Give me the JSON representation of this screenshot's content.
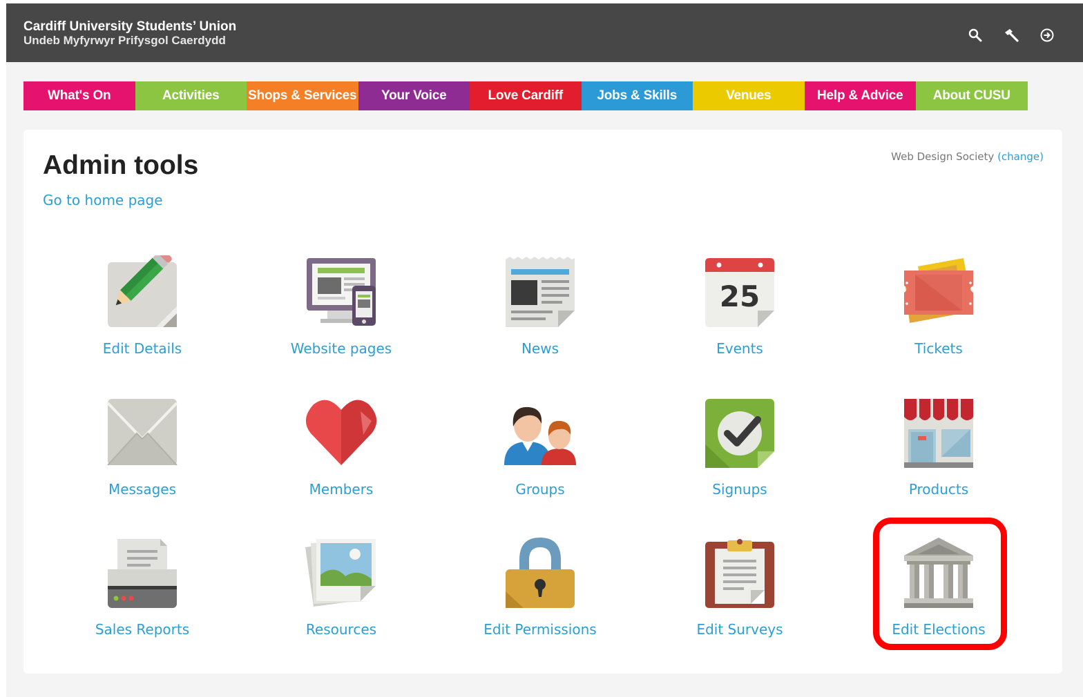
{
  "header": {
    "title_en": "Cardiff University Students’ Union",
    "title_cy": "Undeb Myfyrwyr Prifysgol Caerdydd",
    "icons": [
      "search-icon",
      "hammer-icon",
      "logout-icon"
    ]
  },
  "nav": [
    {
      "label": "What's On",
      "color": "#e5136e"
    },
    {
      "label": "Activities",
      "color": "#8bc541"
    },
    {
      "label": "Shops & Services",
      "color": "#f57f26"
    },
    {
      "label": "Your Voice",
      "color": "#8f2c93"
    },
    {
      "label": "Love Cardiff",
      "color": "#e11d2e"
    },
    {
      "label": "Jobs & Skills",
      "color": "#2b9ad7"
    },
    {
      "label": "Venues",
      "color": "#ebcb00"
    },
    {
      "label": "Help & Advice",
      "color": "#e5136e"
    },
    {
      "label": "About CUSU",
      "color": "#8bc541"
    }
  ],
  "main": {
    "title": "Admin tools",
    "home_link": "Go to home page",
    "society_name": "Web Design Society",
    "society_change": "(change)"
  },
  "tools": [
    {
      "label": "Edit Details",
      "icon": "pencil-icon"
    },
    {
      "label": "Website pages",
      "icon": "monitor-icon"
    },
    {
      "label": "News",
      "icon": "newspaper-icon"
    },
    {
      "label": "Events",
      "icon": "calendar-icon",
      "calendar_day": "25"
    },
    {
      "label": "Tickets",
      "icon": "ticket-icon"
    },
    {
      "label": "Messages",
      "icon": "envelope-icon"
    },
    {
      "label": "Members",
      "icon": "heart-icon"
    },
    {
      "label": "Groups",
      "icon": "people-icon"
    },
    {
      "label": "Signups",
      "icon": "checkmark-icon"
    },
    {
      "label": "Products",
      "icon": "shop-icon"
    },
    {
      "label": "Sales Reports",
      "icon": "printer-icon"
    },
    {
      "label": "Resources",
      "icon": "photos-icon"
    },
    {
      "label": "Edit Permissions",
      "icon": "padlock-icon"
    },
    {
      "label": "Edit Surveys",
      "icon": "clipboard-icon"
    },
    {
      "label": "Edit Elections",
      "icon": "building-icon"
    }
  ],
  "highlight_color": "#ff0000",
  "link_color": "#2a9fd6"
}
